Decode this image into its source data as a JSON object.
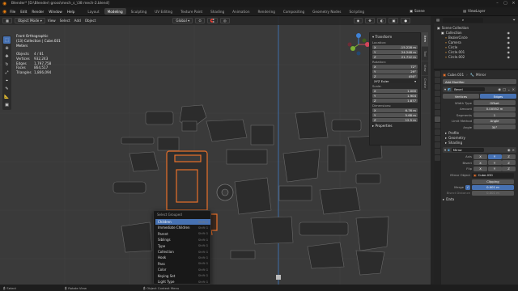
{
  "window": {
    "title": "Blender* [D:\\Blender\\ gross\\mech_s_\\38 mech-2.blend]"
  },
  "menu": [
    "File",
    "Edit",
    "Render",
    "Window",
    "Help"
  ],
  "workspaces": [
    "Layout",
    "Modeling",
    "Sculpting",
    "UV Editing",
    "Texture Paint",
    "Shading",
    "Animation",
    "Rendering",
    "Compositing",
    "Geometry Nodes",
    "Scripting"
  ],
  "active_workspace": "Modeling",
  "scene_label": "Scene",
  "view_layer_label": "ViewLayer",
  "viewport_header": {
    "mode": "Object Mode",
    "view": "View",
    "select": "Select",
    "add": "Add",
    "object": "Object",
    "orientation": "Global"
  },
  "overlay": {
    "line1": "Front Orthographic",
    "line2": "(13) Collection | Cube.031",
    "line3": "Meters"
  },
  "stats": [
    {
      "k": "Objects",
      "v": "4 / 81"
    },
    {
      "k": "Vertices",
      "v": "932,243"
    },
    {
      "k": "Edges",
      "v": "1,797,758"
    },
    {
      "k": "Faces",
      "v": "864,517"
    },
    {
      "k": "Triangles",
      "v": "1,866,094"
    }
  ],
  "npanel": {
    "transform_header": "Transform",
    "location_label": "Location:",
    "location": [
      {
        "a": "X",
        "v": "-15.228 m"
      },
      {
        "a": "Y",
        "v": "24.248 m"
      },
      {
        "a": "Z",
        "v": "21.712 m"
      }
    ],
    "rotation_label": "Rotation:",
    "rotation": [
      {
        "a": "X",
        "v": "72°"
      },
      {
        "a": "Y",
        "v": "29°"
      },
      {
        "a": "Z",
        "v": "450°"
      }
    ],
    "rotation_mode": "XYZ Euler",
    "scale_label": "Scale:",
    "scale": [
      {
        "a": "X",
        "v": "1.000"
      },
      {
        "a": "Y",
        "v": "1.904"
      },
      {
        "a": "Z",
        "v": "1.877"
      }
    ],
    "dimensions_label": "Dimensions:",
    "dimensions": [
      {
        "a": "X",
        "v": "6.76 m"
      },
      {
        "a": "Y",
        "v": "5.68 m"
      },
      {
        "a": "Z",
        "v": "12.5 m"
      }
    ],
    "properties_header": "Properties",
    "tabs": [
      "Item",
      "Tool",
      "View",
      "Create"
    ]
  },
  "context_menu": {
    "title": "Select Grouped",
    "items": [
      {
        "label": "Children",
        "shortcut": "Shift G",
        "highlight": true
      },
      {
        "label": "Immediate Children",
        "shortcut": "Shift G",
        "highlight": false
      },
      {
        "label": "Parent",
        "shortcut": "Shift G",
        "highlight": false
      },
      {
        "label": "Siblings",
        "shortcut": "Shift G",
        "highlight": false
      },
      {
        "label": "Type",
        "shortcut": "Shift G",
        "highlight": false
      },
      {
        "label": "Collection",
        "shortcut": "Shift G",
        "highlight": false
      },
      {
        "label": "Hook",
        "shortcut": "Shift G",
        "highlight": false
      },
      {
        "label": "Pass",
        "shortcut": "Shift G",
        "highlight": false
      },
      {
        "label": "Color",
        "shortcut": "Shift G",
        "highlight": false
      },
      {
        "label": "Keying Set",
        "shortcut": "Shift G",
        "highlight": false
      },
      {
        "label": "Light Type",
        "shortcut": "Shift G",
        "highlight": false
      }
    ]
  },
  "outliner": {
    "header": "Scene Collection",
    "items": [
      "Collection",
      "BezierCircle",
      "Camera",
      "Circle",
      "Circle.001",
      "Circle.002"
    ]
  },
  "properties": {
    "object_name": "Cube.031",
    "modifier_name": "Mirror",
    "add_modifier": "Add Modifier",
    "bevel": {
      "name": "Bevel",
      "vertices": "Vertices",
      "edges": "Edges",
      "width_type_label": "Width Type",
      "width_type": "Offset",
      "amount_label": "Amount",
      "amount": "0.00552 m",
      "segments_label": "Segments",
      "segments": "1",
      "limit_method_label": "Limit Method",
      "limit_method": "Angle",
      "angle_label": "Angle",
      "angle": "30°",
      "subpanels": [
        "Profile",
        "Geometry",
        "Shading"
      ]
    },
    "mirror": {
      "name": "Mirror",
      "axis_label": "Axis",
      "bisect_label": "Bisect",
      "flip_label": "Flip",
      "axes": [
        "X",
        "Y",
        "Z"
      ],
      "mirror_object_label": "Mirror Object",
      "mirror_object": "Cube.030",
      "clipping": "Clipping",
      "merge_label": "Merge",
      "merge_value": "0.001 m",
      "bisect_distance_label": "Bisect Distance",
      "bisect_distance": "0.001 m",
      "data": "Data"
    }
  },
  "statusbar": {
    "select": "Select",
    "rotate": "Rotate View",
    "context": "Object Context Menu"
  },
  "colors": {
    "accent": "#4772b3",
    "selected": "#e8702a",
    "viewport_bg": "#3a3a3a"
  }
}
